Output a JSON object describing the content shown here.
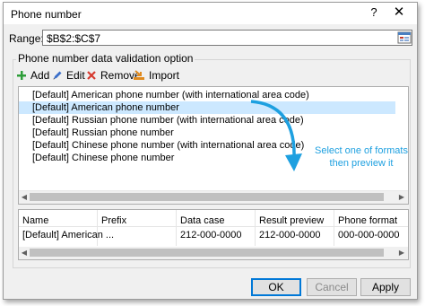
{
  "window": {
    "title": "Phone number",
    "help_label": "?",
    "close_label": "✕"
  },
  "range": {
    "label": "Range:",
    "value": "$B$2:$C$7"
  },
  "group": {
    "title": "Phone number data validation option"
  },
  "toolbar": {
    "add_label": "Add",
    "edit_label": "Edit",
    "remove_label": "Remove",
    "import_label": "Import"
  },
  "formats": [
    "[Default] American phone number (with international area code)",
    "[Default] American phone number",
    "[Default] Russian phone number (with international area code)",
    "[Default] Russian phone number",
    "[Default] Chinese phone number (with international area code)",
    "[Default] Chinese phone number"
  ],
  "selected_format_index": 1,
  "annotation": {
    "line1": "Select one of formats",
    "line2": "then preview it"
  },
  "preview": {
    "headers": [
      "Name",
      "Prefix",
      "Data case",
      "Result preview",
      "Phone format"
    ],
    "row": [
      "[Default] American ...",
      "",
      "212-000-0000",
      "212-000-0000",
      "000-000-0000"
    ]
  },
  "buttons": {
    "ok_label": "OK",
    "cancel_label": "Cancel",
    "apply_label": "Apply"
  },
  "colors": {
    "accent": "#0078d7",
    "annotation": "#1ea0e0",
    "selected_row": "#cce8ff"
  }
}
